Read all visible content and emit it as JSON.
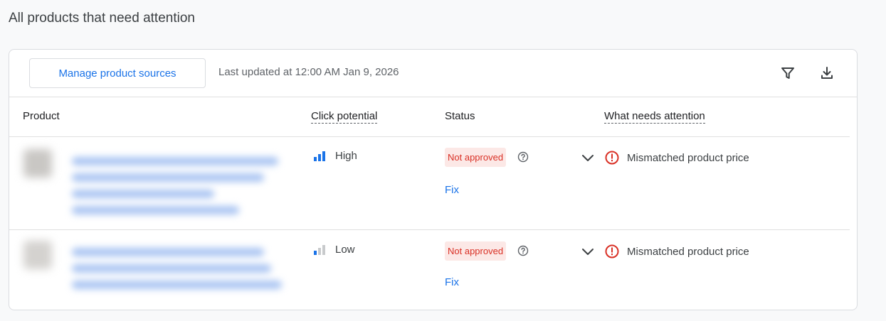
{
  "page": {
    "title": "All products that need attention"
  },
  "toolbar": {
    "manage_label": "Manage product sources",
    "updated_text": "Last updated at 12:00 AM Jan 9, 2026",
    "filter_icon": "filter-icon",
    "download_icon": "download-icon"
  },
  "columns": {
    "product": "Product",
    "click_potential": "Click potential",
    "status": "Status",
    "what_needs_attention": "What needs attention"
  },
  "colors": {
    "accent": "#1a73e8",
    "error": "#d93025",
    "chip_bg": "#fce8e6",
    "bar_inactive": "#c8cacc"
  },
  "rows": [
    {
      "click_potential": "High",
      "potential_bars_active": 3,
      "status": "Not approved",
      "fix_label": "Fix",
      "issue": "Mismatched product price"
    },
    {
      "click_potential": "Low",
      "potential_bars_active": 1,
      "status": "Not approved",
      "fix_label": "Fix",
      "issue": "Mismatched product price"
    }
  ]
}
